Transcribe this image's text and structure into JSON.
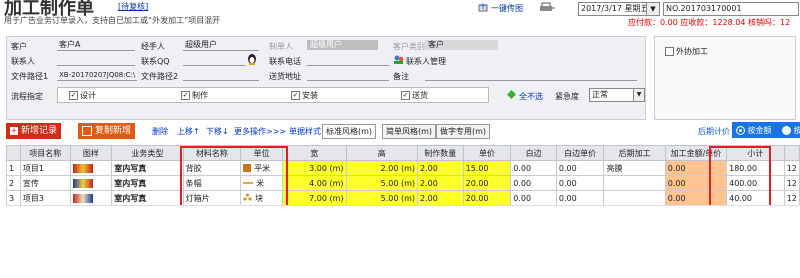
{
  "header": {
    "title": "加工制作单",
    "tag": "[待复核]",
    "subtitle": "用于广告业务订单录入，支持自已加工或“外发加工”项目混开",
    "print_label": "一键传图",
    "date_value": "2017/3/17 星期五 下",
    "order_no": "NO.201703170001",
    "stats": "应付款：0.00  应收款：1228.04  核销吗：12"
  },
  "form": {
    "customer_label": "客户",
    "customer_value": "客户A",
    "manager_label": "经手人",
    "manager_value": "超级用户",
    "maker_label": "制单人",
    "maker_value": "超级用户",
    "custcat_label": "客户类别",
    "custcat_value": "客户",
    "contact_label": "联系人",
    "contact_value": "",
    "qq_label": "联系QQ",
    "qq_value": "",
    "phone_label": "联系电话",
    "phone_value": "",
    "contact_mgmt_label": "联系人管理",
    "path1_label": "文件路径1",
    "path1_value": "XB-20170207JQ08:C:\\",
    "path2_label": "文件路径2",
    "path2_value": "",
    "address_label": "送货地址",
    "address_value": "",
    "note_label": "备注",
    "note_value": "",
    "flow_label": "流程指定",
    "flow_items": [
      "设计",
      "制作",
      "安装",
      "送货"
    ],
    "deselect_all": "全不选",
    "urgency_label": "紧急度",
    "urgency_value": "正常",
    "outsource_label": "外协加工"
  },
  "toolbar": {
    "add_record": "新增记录",
    "copy_add": "复制新增",
    "delete": "删除",
    "move_up": "上移",
    "move_down": "下移",
    "more_ops": "更多操作>>>",
    "single_style": "单据样式",
    "tabs": [
      "标准风格(m)",
      "简单风格(m)",
      "做字专用(m)"
    ],
    "post_calc": "后期计价",
    "by_amount": "按金额",
    "by_other": "按"
  },
  "table": {
    "headers": [
      "",
      "项目名称",
      "图样",
      "业务类型",
      "材料名称",
      "单位",
      "宽",
      "高",
      "制作数量",
      "单价",
      "白边",
      "白边单价",
      "后期加工",
      "加工金额/单价",
      "小计",
      ""
    ],
    "rows": [
      {
        "no": "1",
        "name": "项目1",
        "type": "室内写真",
        "material": "背胶",
        "unit": "平米",
        "w": "3.00 (m)",
        "h": "2.00 (m)",
        "qty": "2.00",
        "price": "15.00",
        "edge": "0.00",
        "edge_price": "0.00",
        "post": "亮膜",
        "proc": "0.00",
        "subtotal": "180.00",
        "extra": "12",
        "swatch": "#c8781c"
      },
      {
        "no": "2",
        "name": "宣传",
        "type": "室内写真",
        "material": "条幅",
        "unit": "米",
        "w": "4.00 (m)",
        "h": "5.00 (m)",
        "qty": "2.00",
        "price": "20.00",
        "edge": "0.00",
        "edge_price": "0.00",
        "post": "",
        "proc": "0.00",
        "subtotal": "400.00",
        "extra": "12",
        "swatch": "#e8a040"
      },
      {
        "no": "3",
        "name": "项目3",
        "type": "室内写真",
        "material": "灯箱片",
        "unit": "块",
        "w": "7.00 (m)",
        "h": "5.00 (m)",
        "qty": "2.00",
        "price": "20.00",
        "edge": "0.00",
        "edge_price": "0.00",
        "post": "",
        "proc": "0.00",
        "subtotal": "40.00",
        "extra": "12",
        "swatch": "#e0901c"
      }
    ]
  },
  "colors": {
    "add_btn": "#d42a1a",
    "copy_btn": "#e05a12",
    "yellow": "#ffff2a",
    "orange": "#ffc490",
    "highlight": "#e02020",
    "radio_bar": "#1a73e8"
  }
}
